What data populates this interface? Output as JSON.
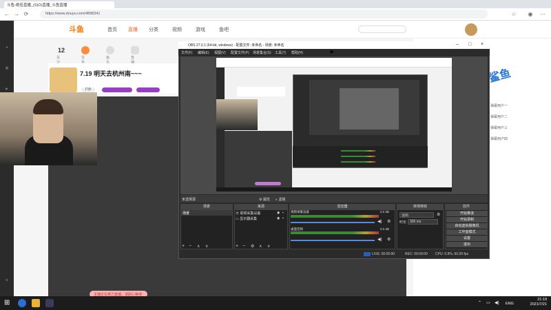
{
  "browser": {
    "tab_title": "斗鱼-绝佳直播_(S)O)直播_斗鱼直播",
    "url": "https://www.douyu.com/4898341"
  },
  "site": {
    "logo": "斗鱼",
    "nav": [
      "首页",
      "直播",
      "分类",
      "视频",
      "游戏",
      "鱼吧"
    ],
    "stats": [
      {
        "value": "12",
        "label": "关注"
      },
      {
        "value": "",
        "label": "任务"
      },
      {
        "value": "",
        "label": "鱼丸"
      },
      {
        "value": "",
        "label": "直播"
      }
    ],
    "room_title": "7.19 明天去杭州南~~~",
    "room_tag": "户外",
    "notice": "主播正在努力直播，请耐心等待",
    "promo_text": "鲨鱼",
    "chat_lines": [
      "弹幕用户一",
      "弹幕用户二",
      "弹幕用户三",
      "弹幕用户四"
    ]
  },
  "obs": {
    "title": "OBS 27.0.1 (64-bit, windows) - 配置文件: 未命名 - 场景: 未命名",
    "menu": [
      "文件(F)",
      "编辑(E)",
      "视图(V)",
      "配置文件(P)",
      "场景集合(S)",
      "工具(T)",
      "帮助(H)"
    ],
    "status_left": "未选择源",
    "status_props": "属性",
    "status_filters": "滤镜",
    "panels": {
      "scenes": "场景",
      "sources": "来源",
      "mixer": "混音器",
      "transitions": "转场特效",
      "controls": "控件"
    },
    "scene_item": "场景",
    "source_items": [
      "视频采集设备",
      "显示器采集"
    ],
    "mixer_tracks": [
      {
        "name": "视频采集设备",
        "db": "0.0 dB"
      },
      {
        "name": "桌面音频",
        "db": "0.0 dB"
      },
      {
        "name": "麦克风/Aux",
        "db": "0.0 dB"
      }
    ],
    "transition_type": "淡出",
    "transition_duration_label": "时长",
    "transition_duration": "300 ms",
    "controls": [
      "开始推流",
      "开始录制",
      "启动虚拟摄像机",
      "工作室模式",
      "设置",
      "退出"
    ],
    "bottom": {
      "live": "LIVE: 00:00:00",
      "rec": "REC: 00:00:00",
      "cpu": "CPU: 0.9%, 60.00 fps"
    }
  },
  "taskbar": {
    "lang": "ENG",
    "time": "21:19",
    "date": "2021/7/21"
  }
}
